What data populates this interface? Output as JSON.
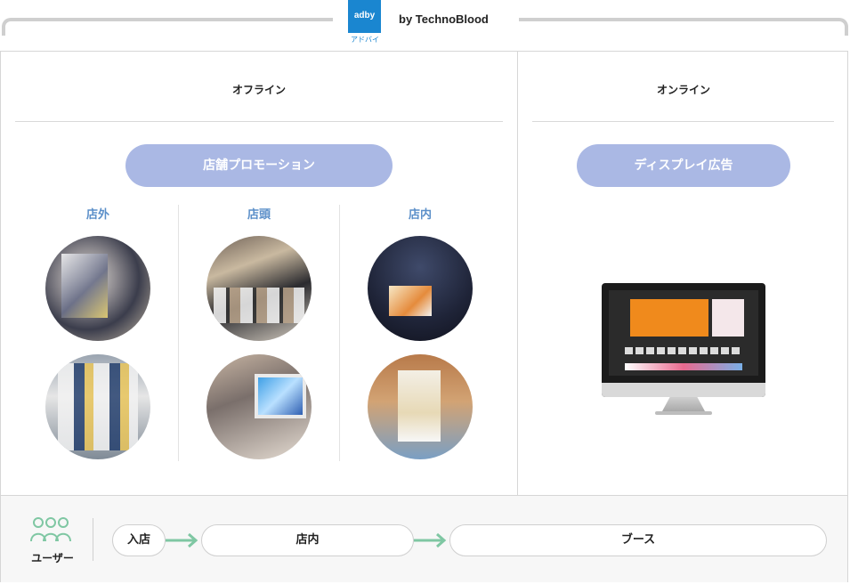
{
  "header": {
    "logo_text": "adby",
    "logo_subtext": "アドバイ",
    "byline": "by TechnoBlood"
  },
  "offline": {
    "title": "オフライン",
    "promo_label": "店舗プロモーション",
    "columns": [
      {
        "label": "店外"
      },
      {
        "label": "店頭"
      },
      {
        "label": "店内"
      }
    ]
  },
  "online": {
    "title": "オンライン",
    "promo_label": "ディスプレイ広告"
  },
  "journey": {
    "user_label": "ユーザー",
    "steps": [
      "入店",
      "店内",
      "ブース"
    ]
  },
  "colors": {
    "pill": "#aab8e4",
    "column_label": "#5b8fc9",
    "arrow": "#7fc7a3",
    "logo": "#1a86d0",
    "user_icon": "#7fc7a3"
  }
}
